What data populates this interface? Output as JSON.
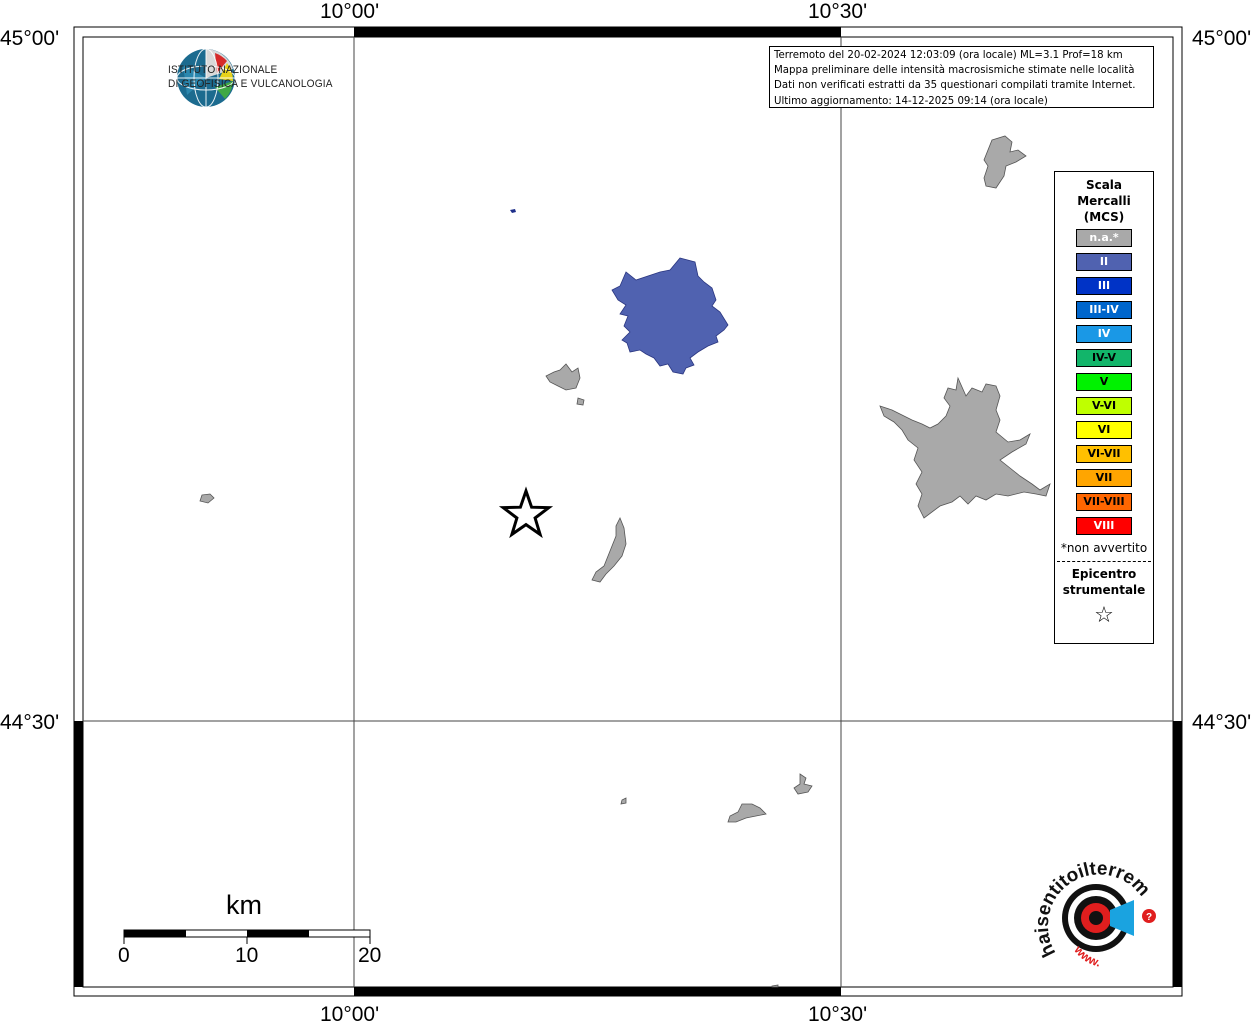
{
  "header": {
    "info_lines": [
      "Terremoto del 20-02-2024 12:03:09 (ora locale) ML=3.1 Prof=18 km",
      "Mappa preliminare delle intensità macrosismiche stimate nelle località",
      "Dati non verificati estratti da 35 questionari compilati tramite Internet.",
      "Ultimo aggiornamento: 14-12-2025 09:14 (ora locale)"
    ]
  },
  "coords": {
    "top": [
      "10°00'",
      "10°30'"
    ],
    "bottom": [
      "10°00'",
      "10°30'"
    ],
    "left": [
      "45°00'",
      "44°30'"
    ],
    "right": [
      "45°00'",
      "44°30'"
    ]
  },
  "logo": {
    "line1": "ISTITUTO NAZIONALE",
    "line2": "DI GEOFISICA E VULCANOLOGIA"
  },
  "legend": {
    "title_lines": [
      "Scala",
      "Mercalli",
      "(MCS)"
    ],
    "items": [
      {
        "label": "n.a.*",
        "color": "#a9a9a9",
        "text_dark": false
      },
      {
        "label": "II",
        "color": "#5062b0",
        "text_dark": false
      },
      {
        "label": "III",
        "color": "#0033c6",
        "text_dark": false
      },
      {
        "label": "III-IV",
        "color": "#0066cc",
        "text_dark": false
      },
      {
        "label": "IV",
        "color": "#1a98e6",
        "text_dark": false
      },
      {
        "label": "IV-V",
        "color": "#12b56a",
        "text_dark": true
      },
      {
        "label": "V",
        "color": "#00f200",
        "text_dark": true
      },
      {
        "label": "V-VI",
        "color": "#bfff00",
        "text_dark": true
      },
      {
        "label": "VI",
        "color": "#ffff00",
        "text_dark": true
      },
      {
        "label": "VI-VII",
        "color": "#ffc000",
        "text_dark": true
      },
      {
        "label": "VII",
        "color": "#ffa500",
        "text_dark": true
      },
      {
        "label": "VII-VIII",
        "color": "#ff6600",
        "text_dark": true
      },
      {
        "label": "VIII",
        "color": "#ff0000",
        "text_dark": false
      }
    ],
    "note": "*non avvertito",
    "epicenter_lines": [
      "Epicentro",
      "strumentale"
    ],
    "epicenter_symbol": "☆"
  },
  "scale_bar": {
    "unit": "km",
    "ticks": [
      "0",
      "10",
      "20"
    ]
  },
  "logo2": {
    "text": "haisentitoilterremoto.it",
    "url": "www."
  },
  "colors": {
    "not_felt_area": "#a9a9a9",
    "intensity_II_area": "#5062b0",
    "gray_outline": "#555555"
  }
}
